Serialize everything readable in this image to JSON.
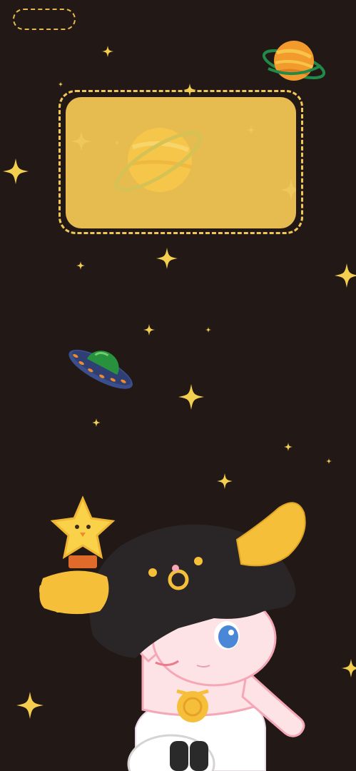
{
  "screen": {
    "background": "#221816",
    "accent": "#e6bb4f",
    "star_color": "#f4cf4f"
  },
  "top_left_placeholder": {
    "kind": "dashed-pill",
    "icon": "dashed-slot-icon"
  },
  "widget": {
    "kind": "dashed-widget-slot",
    "card_color": "#e6bb4f",
    "icon": "saturn-planet-icon"
  },
  "decorations": {
    "planet": "orange-ringed-planet-icon",
    "ufo": "ufo-icon",
    "character": "taurus-character-illustration",
    "star": "sparkle-star-icon"
  }
}
